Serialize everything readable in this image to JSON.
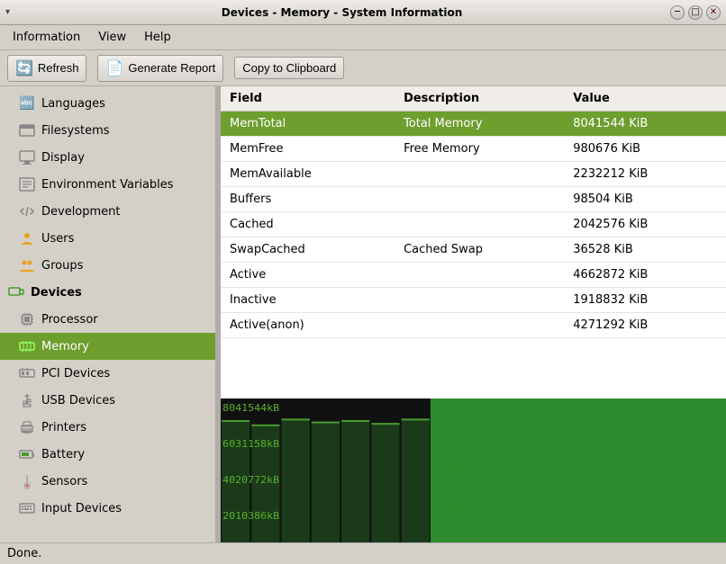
{
  "window": {
    "title": "Devices - Memory - System Information",
    "minimize": "─",
    "restore": "□",
    "close": "✕"
  },
  "menubar": {
    "items": [
      {
        "label": "Information",
        "id": "information"
      },
      {
        "label": "View",
        "id": "view"
      },
      {
        "label": "Help",
        "id": "help"
      }
    ]
  },
  "toolbar": {
    "refresh_label": "Refresh",
    "generate_label": "Generate Report",
    "clipboard_label": "Copy to Clipboard"
  },
  "sidebar": {
    "items": [
      {
        "label": "Languages",
        "id": "languages",
        "icon": "🔤",
        "active": false,
        "indent": true
      },
      {
        "label": "Filesystems",
        "id": "filesystems",
        "icon": "🖥",
        "active": false,
        "indent": true
      },
      {
        "label": "Display",
        "id": "display",
        "icon": "🖥",
        "active": false,
        "indent": true
      },
      {
        "label": "Environment Variables",
        "id": "envvars",
        "icon": "🖥",
        "active": false,
        "indent": true
      },
      {
        "label": "Development",
        "id": "development",
        "icon": "🔧",
        "active": false,
        "indent": true
      },
      {
        "label": "Users",
        "id": "users",
        "icon": "👥",
        "active": false,
        "indent": true
      },
      {
        "label": "Groups",
        "id": "groups",
        "icon": "👥",
        "active": false,
        "indent": true
      },
      {
        "label": "Devices",
        "id": "devices",
        "icon": "🖥",
        "active": false,
        "category": true
      },
      {
        "label": "Processor",
        "id": "processor",
        "icon": "⚙",
        "active": false,
        "indent": true
      },
      {
        "label": "Memory",
        "id": "memory",
        "icon": "🟩",
        "active": true,
        "indent": true
      },
      {
        "label": "PCI Devices",
        "id": "pci",
        "icon": "🔲",
        "active": false,
        "indent": true
      },
      {
        "label": "USB Devices",
        "id": "usb",
        "icon": "🔌",
        "active": false,
        "indent": true
      },
      {
        "label": "Printers",
        "id": "printers",
        "icon": "🖨",
        "active": false,
        "indent": true
      },
      {
        "label": "Battery",
        "id": "battery",
        "icon": "🔋",
        "active": false,
        "indent": true
      },
      {
        "label": "Sensors",
        "id": "sensors",
        "icon": "🌡",
        "active": false,
        "indent": true
      },
      {
        "label": "Input Devices",
        "id": "input",
        "icon": "⌨",
        "active": false,
        "indent": true
      }
    ]
  },
  "table": {
    "columns": [
      {
        "label": "Field"
      },
      {
        "label": "Description"
      },
      {
        "label": "Value"
      }
    ],
    "rows": [
      {
        "field": "MemTotal",
        "description": "Total Memory",
        "value": "8041544 KiB",
        "highlighted": true
      },
      {
        "field": "MemFree",
        "description": "Free Memory",
        "value": "980676 KiB",
        "highlighted": false
      },
      {
        "field": "MemAvailable",
        "description": "",
        "value": "2232212 KiB",
        "highlighted": false
      },
      {
        "field": "Buffers",
        "description": "",
        "value": "98504 KiB",
        "highlighted": false
      },
      {
        "field": "Cached",
        "description": "",
        "value": "2042576 KiB",
        "highlighted": false
      },
      {
        "field": "SwapCached",
        "description": "Cached Swap",
        "value": "36528 KiB",
        "highlighted": false
      },
      {
        "field": "Active",
        "description": "",
        "value": "4662872 KiB",
        "highlighted": false
      },
      {
        "field": "Inactive",
        "description": "",
        "value": "1918832 KiB",
        "highlighted": false
      },
      {
        "field": "Active(anon)",
        "description": "",
        "value": "4271292 KiB",
        "highlighted": false
      }
    ]
  },
  "chart": {
    "labels": [
      "8041544kB",
      "6031158kB",
      "4020772kB",
      "2010386kB"
    ],
    "colors": {
      "background": "#000000",
      "bar_left": "#1a1a1a",
      "bar_right": "#2d8a2d",
      "grid": "#3a5a3a"
    }
  },
  "statusbar": {
    "text": "Done."
  }
}
